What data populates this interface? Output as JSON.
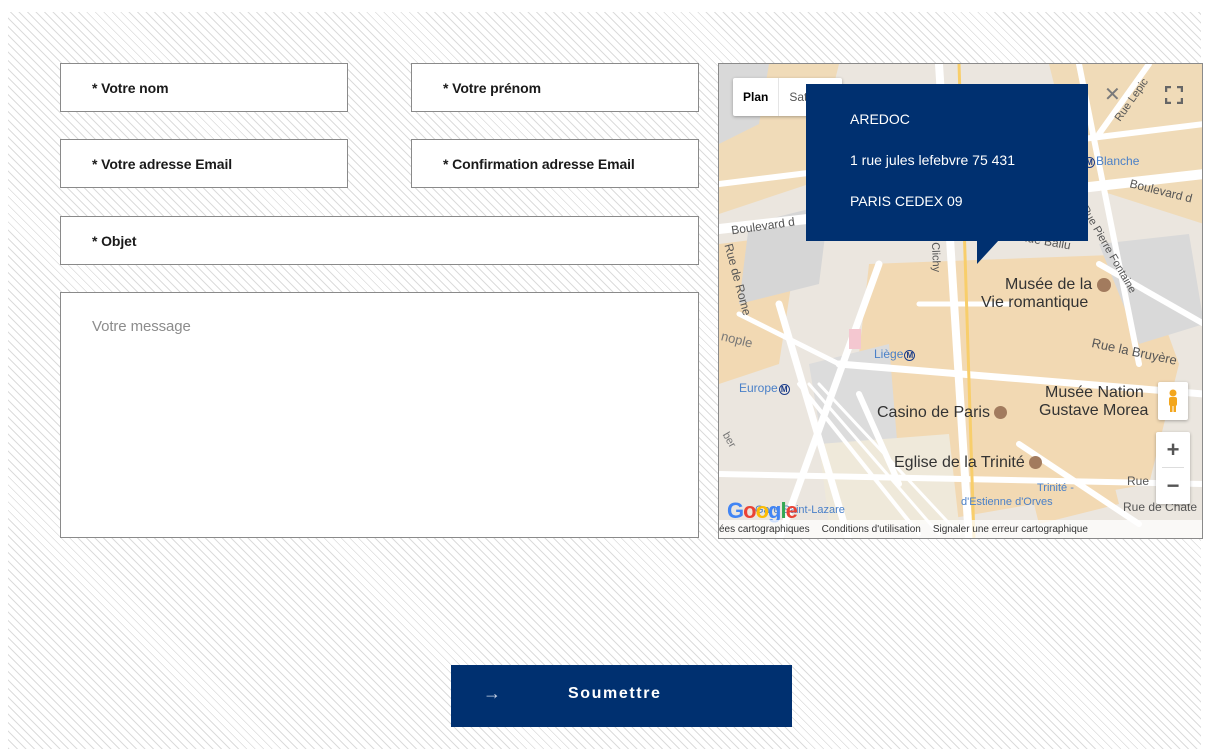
{
  "form": {
    "nom_label": "* Votre nom",
    "prenom_label": "* Votre prénom",
    "email_label": "* Votre adresse Email",
    "confirm_label": "* Confirmation adresse Email",
    "objet_label": "* Objet",
    "message_placeholder": "Votre message"
  },
  "map": {
    "type_plan": "Plan",
    "type_satellite": "Satellite",
    "info": {
      "name": "AREDOC",
      "address": "1 rue jules lefebvre 75 431",
      "city": "PARIS CEDEX 09"
    },
    "labels": {
      "blanche": "Blanche",
      "boulevard_left": "Boulevard d",
      "boulevard_right": "Boulevard d",
      "rue_ballu": "Rue Ballu",
      "rue_pierre_fontaine": "Rue Pierre Fontaine",
      "rue_lepic": "Rue Lepic",
      "clichy": "Clichy",
      "rue_de_rome": "Rue de Rome",
      "musee_vie": "Musée de la",
      "musee_vie2": "Vie romantique",
      "nople": "nople",
      "liege": "Liège",
      "rue_la_bruyere": "Rue la Bruyère",
      "europe": "Europe",
      "musee_national": "Musée Nation",
      "gustave": "Gustave Morea",
      "casino": "Casino de Paris",
      "trinite": "Eglise de la Trinité",
      "trinite_station": "Trinité -",
      "estienne": "d'Estienne d'Orves",
      "rue_de_chat": "Rue de Châte",
      "rue_l": "Rue",
      "gare": "Gare Saint-Lazare",
      "ber": "ber"
    },
    "footer": {
      "data": "ées cartographiques",
      "terms": "Conditions d'utilisation",
      "report": "Signaler une erreur cartographique"
    },
    "google": "Google",
    "zoom_in": "+",
    "zoom_out": "−"
  },
  "submit": {
    "label": "Soumettre"
  },
  "colors": {
    "brand": "#003070",
    "border": "#8a8a8a"
  }
}
